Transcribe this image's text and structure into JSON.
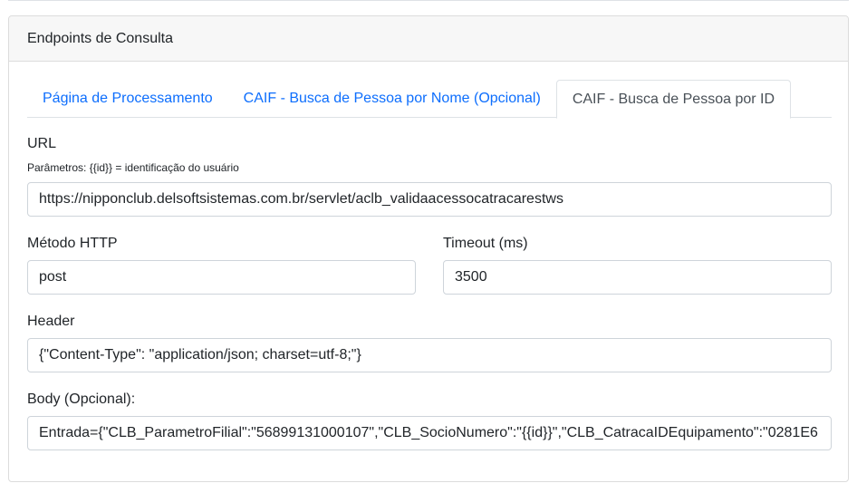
{
  "card": {
    "title": "Endpoints de Consulta"
  },
  "tabs": [
    {
      "label": "Página de Processamento",
      "active": false
    },
    {
      "label": "CAIF - Busca de Pessoa por Nome (Opcional)",
      "active": false
    },
    {
      "label": "CAIF - Busca de Pessoa por ID",
      "active": true
    }
  ],
  "form": {
    "url": {
      "label": "URL",
      "help": "Parâmetros: {{id}} = identificação do usuário",
      "value": "https://nipponclub.delsoftsistemas.com.br/servlet/aclb_validaacessocatracarestws"
    },
    "method": {
      "label": "Método HTTP",
      "value": "post"
    },
    "timeout": {
      "label": "Timeout (ms)",
      "value": "3500"
    },
    "header": {
      "label": "Header",
      "value": "{\"Content-Type\": \"application/json; charset=utf-8;\"}"
    },
    "body": {
      "label": "Body (Opcional):",
      "value": "Entrada={\"CLB_ParametroFilial\":\"56899131000107\",\"CLB_SocioNumero\":\"{{id}}\",\"CLB_CatracaIDEquipamento\":\"0281E6"
    }
  },
  "colors": {
    "link": "#0d6efd",
    "border": "#ced4da",
    "header_bg": "#f7f7f7"
  }
}
